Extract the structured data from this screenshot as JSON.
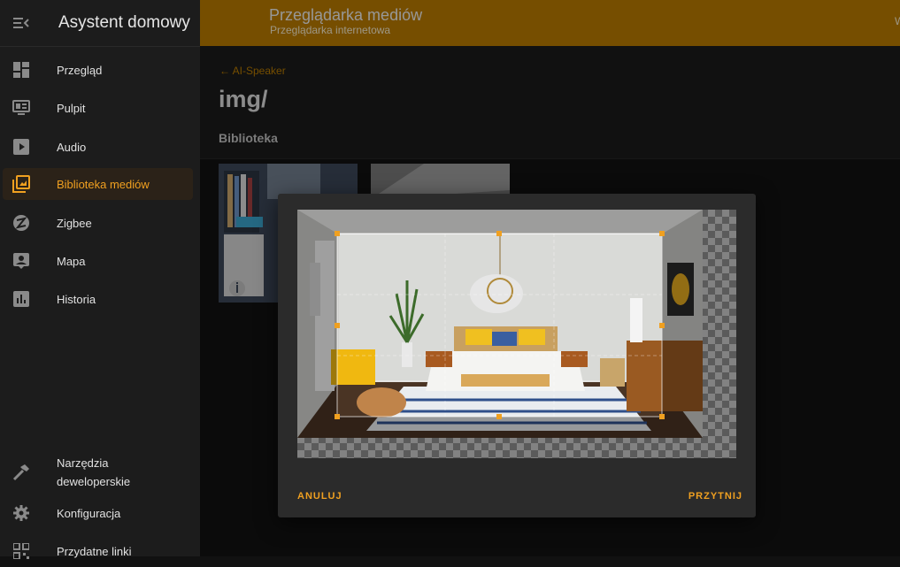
{
  "sidebar": {
    "title": "Asystent domowy",
    "items": [
      {
        "label": "Przegląd",
        "icon": "dashboard-icon"
      },
      {
        "label": "Pulpit",
        "icon": "monitor-dashboard-icon"
      },
      {
        "label": "Audio",
        "icon": "play-box-icon"
      },
      {
        "label": "Biblioteka mediów",
        "icon": "image-library-icon",
        "active": true
      },
      {
        "label": "Zigbee",
        "icon": "zigbee-icon"
      },
      {
        "label": "Mapa",
        "icon": "account-box-icon"
      },
      {
        "label": "Historia",
        "icon": "chart-box-icon"
      }
    ],
    "bottom_items": [
      {
        "label": "Narzędzia deweloperskie",
        "icon": "hammer-icon"
      },
      {
        "label": "Konfiguracja",
        "icon": "cog-icon"
      },
      {
        "label": "Przydatne linki",
        "icon": "qrcode-icon"
      }
    ]
  },
  "header": {
    "title": "Przeglądarka mediów",
    "subtitle": "Przeglądarka internetowa",
    "right_text": "W"
  },
  "main": {
    "back_label": "AI-Speaker",
    "page_title": "img/",
    "section_title": "Biblioteka"
  },
  "dialog": {
    "cancel_label": "ANULUJ",
    "crop_label": "PRZYTNIJ"
  },
  "colors": {
    "accent": "#b57900",
    "accent_text": "#f0a020",
    "sidebar_bg": "#1c1c1c",
    "dialog_bg": "#2b2b2b"
  }
}
